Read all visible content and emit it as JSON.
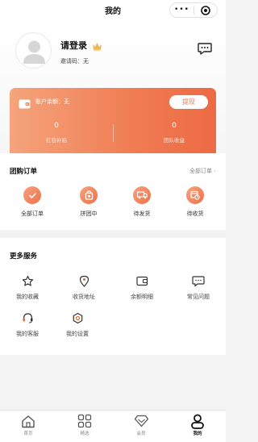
{
  "nav": {
    "title": "我的",
    "more_glyph": "•••"
  },
  "profile": {
    "login_text": "请登录",
    "invite_label": "邀请码",
    "invite_value": "无",
    "avatar_icon": "user-silhouette-icon",
    "crown_icon": "crown-icon",
    "message_icon": "chat-bubble-icon"
  },
  "wallet": {
    "balance_label": "账户余额：无",
    "withdraw_label": "提现",
    "stats": [
      {
        "value": "0",
        "label": "红包补贴"
      },
      {
        "value": "0",
        "label": "团队收益"
      }
    ],
    "colors": {
      "start": "#f5a47c",
      "end": "#ec6a44"
    }
  },
  "orders": {
    "title": "团购订单",
    "all_label": "全部订单",
    "items": [
      {
        "label": "全部订单",
        "icon": "check-icon"
      },
      {
        "label": "拼团中",
        "icon": "shopping-bag-icon"
      },
      {
        "label": "待发货",
        "icon": "delivery-truck-icon"
      },
      {
        "label": "待收货",
        "icon": "package-clock-icon"
      }
    ]
  },
  "services": {
    "title": "更多服务",
    "items": [
      {
        "label": "我的收藏",
        "icon": "star-icon"
      },
      {
        "label": "收货地址",
        "icon": "location-pin-icon"
      },
      {
        "label": "余额明细",
        "icon": "wallet-icon"
      },
      {
        "label": "常见问题",
        "icon": "question-chat-icon"
      },
      {
        "label": "我的客服",
        "icon": "customer-service-icon"
      },
      {
        "label": "我的设置",
        "icon": "settings-gear-icon"
      }
    ]
  },
  "tabbar": {
    "items": [
      {
        "label": "首页",
        "icon": "home-icon",
        "active": false
      },
      {
        "label": "精选",
        "icon": "grid-icon",
        "active": false
      },
      {
        "label": "会员",
        "icon": "diamond-icon",
        "active": false
      },
      {
        "label": "我的",
        "icon": "profile-icon",
        "active": true
      }
    ]
  },
  "accent_color": "#ef7a50"
}
